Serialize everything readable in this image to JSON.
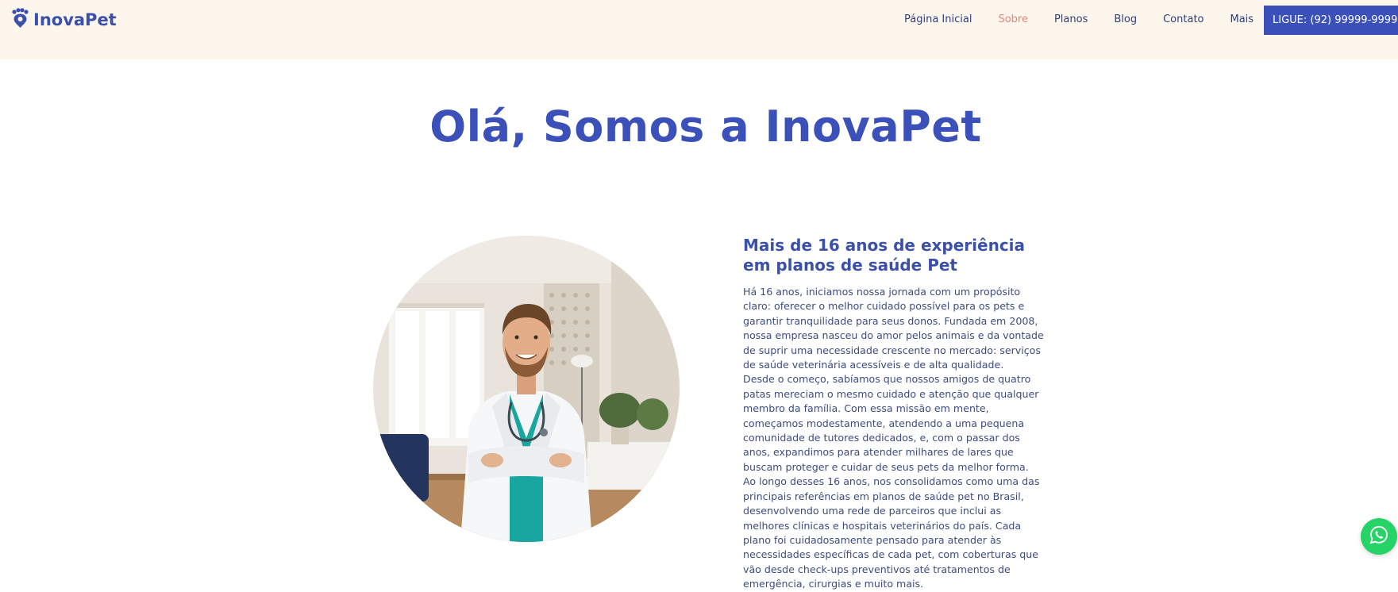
{
  "brand": {
    "name": "InovaPet",
    "logo_icon": "paw-pin-icon",
    "primary_color": "#3b50b8",
    "header_bg": "#fdf6ed",
    "active_link_color": "#e2897c"
  },
  "nav": {
    "items": [
      {
        "label": "Página Inicial",
        "active": false
      },
      {
        "label": "Sobre",
        "active": true
      },
      {
        "label": "Planos",
        "active": false
      },
      {
        "label": "Blog",
        "active": false
      },
      {
        "label": "Contato",
        "active": false
      },
      {
        "label": "Mais",
        "active": false
      }
    ],
    "cta_label": "LIGUE: (92) 99999-9999"
  },
  "hero": {
    "title": "Olá, Somos a InovaPet"
  },
  "about": {
    "image": "veterinarian-portrait",
    "heading_line1": "Mais de 16 anos de experiência",
    "heading_line2": "em planos de saúde Pet",
    "paragraph1": "Há 16 anos, iniciamos nossa jornada com um propósito claro: oferecer o melhor cuidado possível para os pets e garantir tranquilidade para seus donos. Fundada em 2008, nossa empresa nasceu do amor pelos animais e da vontade de suprir uma necessidade crescente no mercado: serviços de saúde veterinária acessíveis e de alta qualidade.",
    "paragraph2": "Desde o começo, sabíamos que nossos amigos de quatro patas mereciam o mesmo cuidado e atenção que qualquer membro da família. Com essa missão em mente, começamos modestamente, atendendo a uma pequena comunidade de tutores dedicados, e, com o passar dos anos, expandimos para atender milhares de lares que buscam proteger e cuidar de seus pets da melhor forma.",
    "paragraph3": "Ao longo desses 16 anos, nos consolidamos como uma das principais referências em planos de saúde pet no Brasil, desenvolvendo uma rede de parceiros que inclui as melhores clínicas e hospitais veterinários do país. Cada plano foi cuidadosamente pensado para atender às necessidades específicas de cada pet, com coberturas que vão desde check-ups preventivos até tratamentos de emergência, cirurgias e muito mais."
  },
  "floating": {
    "whatsapp_icon": "whatsapp-icon",
    "whatsapp_color": "#25d366"
  }
}
